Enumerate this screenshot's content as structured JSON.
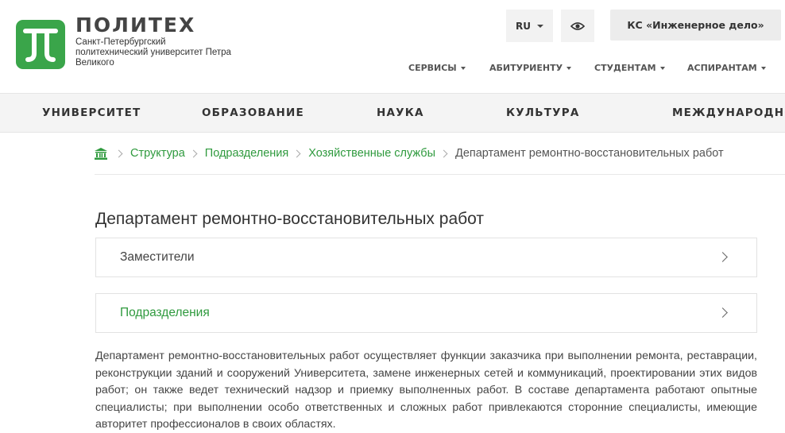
{
  "header": {
    "logo_title": "ПОЛИТЕХ",
    "logo_subtitle": "Санкт-Петербургский политехнический университет Петра Великого",
    "lang_label": "RU",
    "ks_button": "КС «Инженерное дело»",
    "top_nav": [
      "СЕРВИСЫ",
      "АБИТУРИЕНТУ",
      "СТУДЕНТАМ",
      "АСПИРАНТАМ"
    ]
  },
  "main_nav": [
    "УНИВЕРСИТЕТ",
    "ОБРАЗОВАНИЕ",
    "НАУКА",
    "КУЛЬТУРА",
    "МЕЖДУНАРОДНОЕ"
  ],
  "breadcrumb": {
    "links": [
      "Структура",
      "Подразделения",
      "Хозяйственные службы"
    ],
    "current": "Департамент ремонтно-восстановительных работ"
  },
  "page": {
    "title": "Департамент ремонтно-восстановительных работ",
    "accordion": [
      {
        "label": "Заместители"
      },
      {
        "label": "Подразделения"
      }
    ],
    "description": "Департамент ремонтно-восстановительных работ осуществляет функции заказчика при выполнении ремонта, реставрации, реконструкции зданий и сооружений Университета, замене инженерных сетей и коммуникаций, проектировании этих видов работ; он также ведет технический надзор и приемку выполненных работ. В составе департамента работают опытные специалисты; при выполнении особо ответственных и сложных работ привлекаются сторонние специалисты, имеющие авторитет профессионалов в своих областях."
  },
  "colors": {
    "brand_green": "#3aa54a",
    "link_green": "#2f9a3e",
    "nav_bg": "#f4f4f4"
  },
  "icons": {
    "home": "home-icon",
    "visibility": "eye-icon"
  }
}
